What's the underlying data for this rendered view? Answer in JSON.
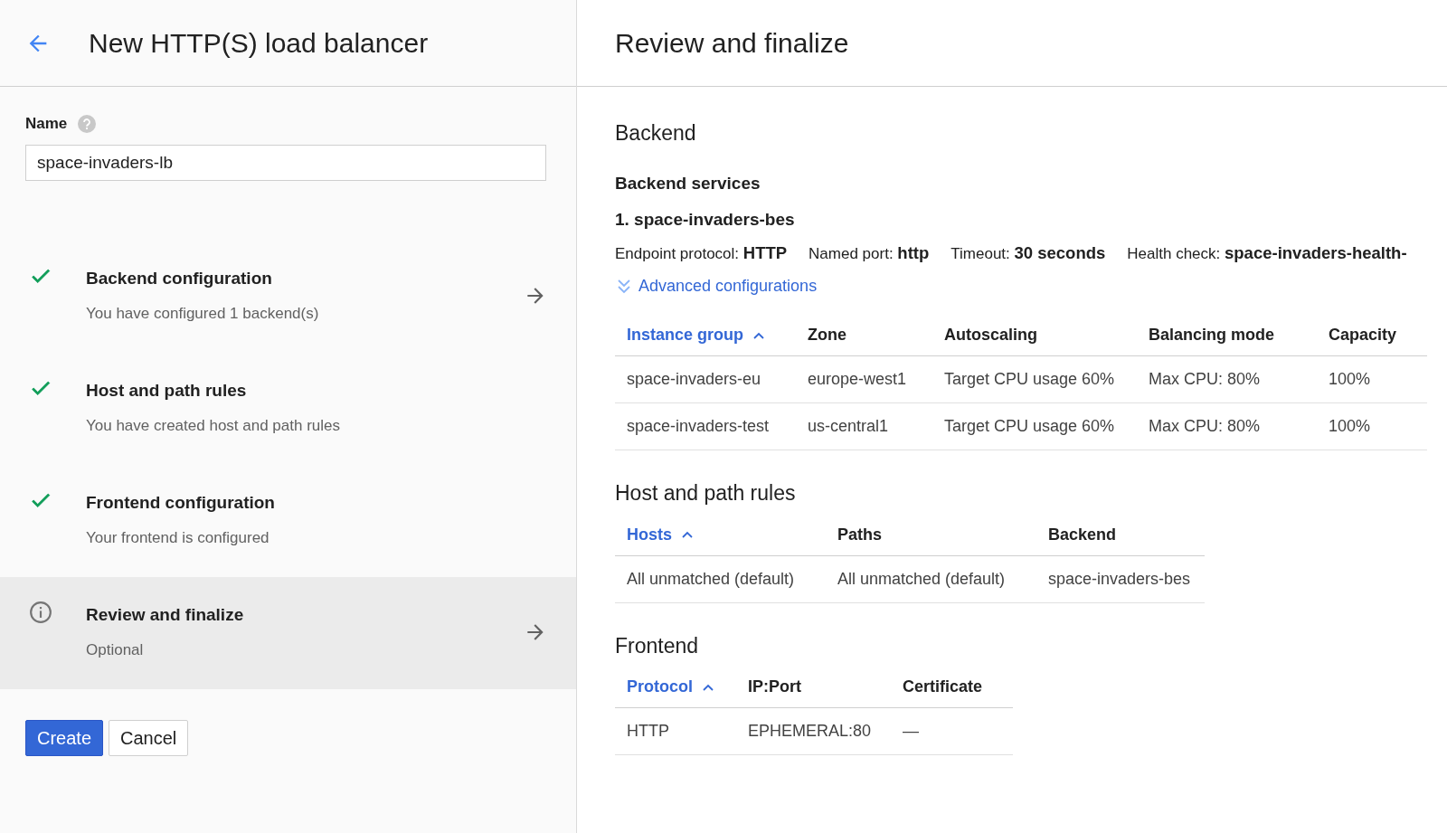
{
  "left_header": {
    "title": "New HTTP(S) load balancer"
  },
  "name_field": {
    "label": "Name",
    "value": "space-invaders-lb"
  },
  "steps": [
    {
      "kind": "done",
      "title": "Backend configuration",
      "subtitle": "You have configured 1 backend(s)",
      "selected": false,
      "arrow": true
    },
    {
      "kind": "done",
      "title": "Host and path rules",
      "subtitle": "You have created host and path rules",
      "selected": false,
      "arrow": false
    },
    {
      "kind": "done",
      "title": "Frontend configuration",
      "subtitle": "Your frontend is configured",
      "selected": false,
      "arrow": false
    },
    {
      "kind": "info",
      "title": "Review and finalize",
      "subtitle": "Optional",
      "selected": true,
      "arrow": true
    }
  ],
  "buttons": [
    {
      "label": "Create",
      "primary": true
    },
    {
      "label": "Cancel",
      "primary": false
    }
  ],
  "right_header": {
    "title": "Review and finalize"
  },
  "backend": {
    "heading": "Backend",
    "subheading": "Backend services",
    "service_title": "1. space-invaders-bes",
    "details": [
      {
        "label": "Endpoint protocol:",
        "value": "HTTP"
      },
      {
        "label": "Named port:",
        "value": "http"
      },
      {
        "label": "Timeout:",
        "value": "30 seconds"
      },
      {
        "label": "Health check:",
        "value": "space-invaders-health-"
      }
    ],
    "advanced_link": "Advanced configurations",
    "table": {
      "columns": [
        {
          "label": "Instance group",
          "sorted": true
        },
        {
          "label": "Zone",
          "sorted": false
        },
        {
          "label": "Autoscaling",
          "sorted": false
        },
        {
          "label": "Balancing mode",
          "sorted": false
        },
        {
          "label": "Capacity",
          "sorted": false
        }
      ],
      "rows": [
        [
          "space-invaders-eu",
          "europe-west1",
          "Target CPU usage 60%",
          "Max CPU: 80%",
          "100%"
        ],
        [
          "space-invaders-test",
          "us-central1",
          "Target CPU usage 60%",
          "Max CPU: 80%",
          "100%"
        ]
      ]
    }
  },
  "host_rules": {
    "heading": "Host and path rules",
    "table": {
      "columns": [
        {
          "label": "Hosts",
          "sorted": true
        },
        {
          "label": "Paths",
          "sorted": false
        },
        {
          "label": "Backend",
          "sorted": false
        }
      ],
      "rows": [
        [
          "All unmatched (default)",
          "All unmatched (default)",
          "space-invaders-bes"
        ]
      ]
    }
  },
  "frontend": {
    "heading": "Frontend",
    "table": {
      "columns": [
        {
          "label": "Protocol",
          "sorted": true
        },
        {
          "label": "IP:Port",
          "sorted": false
        },
        {
          "label": "Certificate",
          "sorted": false
        }
      ],
      "rows": [
        [
          "HTTP",
          "EPHEMERAL:80",
          "—"
        ]
      ]
    }
  }
}
